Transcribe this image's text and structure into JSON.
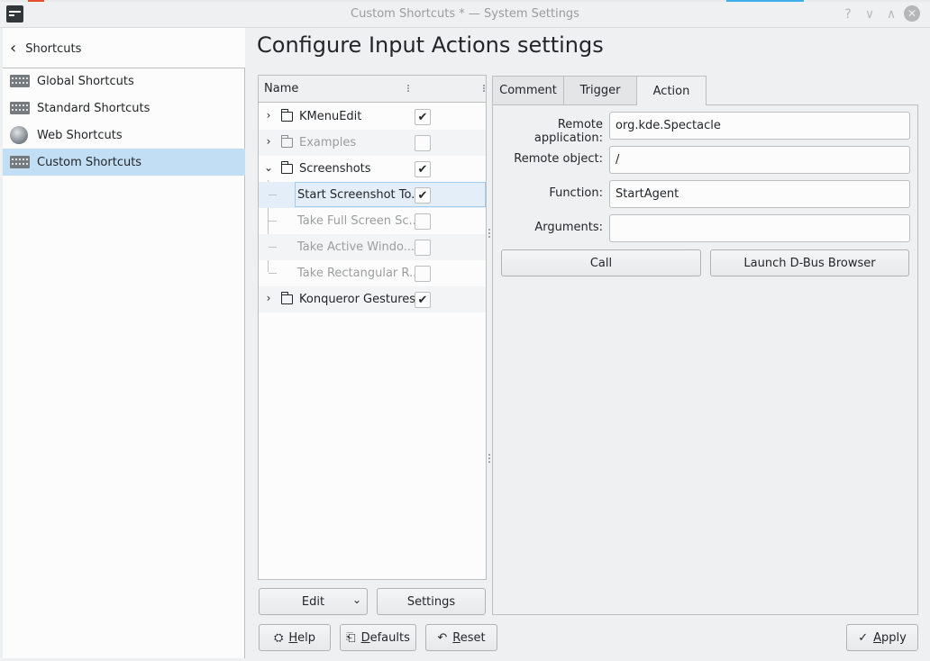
{
  "window": {
    "title": "Custom Shortcuts * — System Settings",
    "help_glyph": "?",
    "minimize_glyph": "∨",
    "maximize_glyph": "∧",
    "close_glyph": "✕"
  },
  "sidebar": {
    "back_label": "Shortcuts",
    "back_glyph": "‹",
    "items": [
      {
        "label": "Global Shortcuts",
        "icon": "keyboard-icon",
        "selected": false
      },
      {
        "label": "Standard Shortcuts",
        "icon": "keyboard-icon",
        "selected": false
      },
      {
        "label": "Web Shortcuts",
        "icon": "globe-icon",
        "selected": false
      },
      {
        "label": "Custom Shortcuts",
        "icon": "keyboard-icon",
        "selected": true
      }
    ]
  },
  "main": {
    "title": "Configure Input Actions settings"
  },
  "tree": {
    "column_header": "Name",
    "rows": [
      {
        "label": "KMenuEdit",
        "expander": "›",
        "checked": true,
        "dim": false
      },
      {
        "label": "Examples",
        "expander": "›",
        "checked": false,
        "dim": true
      },
      {
        "label": "Screenshots",
        "expander": "⌄",
        "checked": true,
        "dim": false
      },
      {
        "label": "Start Screenshot To...",
        "checked": true,
        "dim": false,
        "selected": true
      },
      {
        "label": "Take Full Screen Sc...",
        "checked": false,
        "dim": true
      },
      {
        "label": "Take Active Windo...",
        "checked": false,
        "dim": true
      },
      {
        "label": "Take Rectangular R...",
        "checked": false,
        "dim": true
      },
      {
        "label": "Konqueror Gestures",
        "expander": "›",
        "checked": true,
        "dim": false
      }
    ],
    "check_glyph": "✔",
    "edit_button": "Edit",
    "edit_caret": "⌄",
    "settings_button": "Settings"
  },
  "tabs": [
    {
      "label": "Comment",
      "active": false
    },
    {
      "label": "Trigger",
      "active": false
    },
    {
      "label": "Action",
      "active": true
    }
  ],
  "action": {
    "remote_app_label": "Remote application:",
    "remote_app_value": "org.kde.Spectacle",
    "remote_obj_label": "Remote object:",
    "remote_obj_value": "/",
    "function_label": "Function:",
    "function_value": "StartAgent",
    "arguments_label": "Arguments:",
    "arguments_value": "",
    "call_button": "Call",
    "dbus_button": "Launch D-Bus Browser"
  },
  "footer": {
    "help_underlined": "H",
    "help_rest": "elp",
    "help_icon_glyph": "⛭",
    "defaults_underlined": "D",
    "defaults_rest": "efaults",
    "defaults_icon_glyph": "⎗",
    "reset_underlined": "R",
    "reset_rest": "eset",
    "reset_icon_glyph": "↶",
    "apply_underlined": "A",
    "apply_rest": "pply",
    "apply_icon_glyph": "✓"
  }
}
